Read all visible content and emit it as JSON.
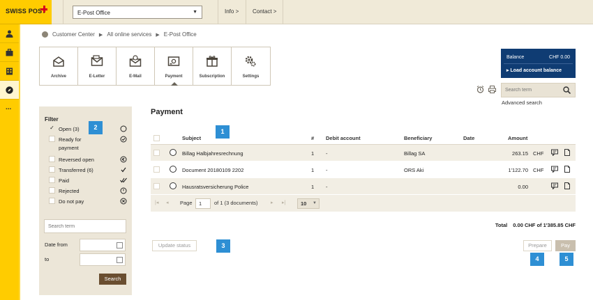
{
  "header": {
    "logo_text": "SWISS POST",
    "app_selector": "E-Post Office",
    "links": [
      "Info >",
      "Contact >"
    ]
  },
  "sidebar": {
    "icons": [
      "person-icon",
      "briefcase-icon",
      "building-icon",
      "compass-icon",
      "more-icon"
    ],
    "more_label": "..."
  },
  "breadcrumb": [
    "Customer Center",
    "All online services",
    "E-Post Office"
  ],
  "tiles": [
    {
      "label": "Archive",
      "icon": "archive-icon"
    },
    {
      "label": "E-Letter",
      "icon": "e-letter-icon"
    },
    {
      "label": "E-Mail",
      "icon": "e-mail-icon"
    },
    {
      "label": "Payment",
      "icon": "payment-icon",
      "active": true
    },
    {
      "label": "Subscription",
      "icon": "subscription-icon"
    },
    {
      "label": "Settings",
      "icon": "settings-icon"
    }
  ],
  "balance": {
    "label": "Balance",
    "amount": "CHF 0.00",
    "load_label": "▸ Load account balance"
  },
  "search": {
    "placeholder": "Search term",
    "advanced": "Advanced search"
  },
  "filter": {
    "title": "Filter",
    "items": [
      {
        "label": "Open (3)",
        "checked": true,
        "icon": "circle-icon"
      },
      {
        "label": "Ready for payment",
        "checked": false,
        "icon": "check-circle-icon"
      },
      {
        "label": "Reversed open",
        "checked": false,
        "icon": "euro-circle-icon"
      },
      {
        "label": "Transferred (6)",
        "checked": false,
        "icon": "check-icon"
      },
      {
        "label": "Paid",
        "checked": false,
        "icon": "double-check-icon"
      },
      {
        "label": "Rejected",
        "checked": false,
        "icon": "power-icon"
      },
      {
        "label": "Do not pay",
        "checked": false,
        "icon": "x-circle-icon"
      }
    ],
    "check_mark": "✓",
    "search_placeholder": "Search term",
    "date_from": "Date from",
    "date_to": "to",
    "search_button": "Search"
  },
  "main": {
    "title": "Payment",
    "columns": [
      "Subject",
      "#",
      "Debit account",
      "Beneficiary",
      "Date",
      "Amount"
    ],
    "rows": [
      {
        "subject": "Billag Halbjahresrechnung",
        "count": "1",
        "debit": "-",
        "beneficiary": "Billag SA",
        "date": "",
        "amount": "263.15",
        "currency": "CHF"
      },
      {
        "subject": "Document 20180109 2202",
        "count": "1",
        "debit": "-",
        "beneficiary": "ORS Aki",
        "date": "",
        "amount": "1'122.70",
        "currency": "CHF"
      },
      {
        "subject": "Hausratsversicherung Police",
        "count": "1",
        "debit": "-",
        "beneficiary": "",
        "date": "",
        "amount": "0.00",
        "currency": ""
      }
    ],
    "pager": {
      "page_label": "Page",
      "page_value": "1",
      "of_label": "of 1 (3 documents)",
      "page_size": "10",
      "nav": [
        "|◂",
        "◂",
        "▸",
        "▸|"
      ]
    },
    "total": {
      "label": "Total",
      "value": "0.00 CHF of 1'385.85 CHF"
    },
    "buttons": {
      "update": "Update status",
      "prepare": "Prepare",
      "pay": "Pay"
    }
  },
  "callouts": [
    "1",
    "2",
    "3",
    "4",
    "5"
  ],
  "colors": {
    "brand_yellow": "#ffcc00",
    "brand_red": "#d7001c",
    "balance_blue": "#0f3c73",
    "callout_blue": "#2e8fd4",
    "search_button_brown": "#6a4e30"
  }
}
